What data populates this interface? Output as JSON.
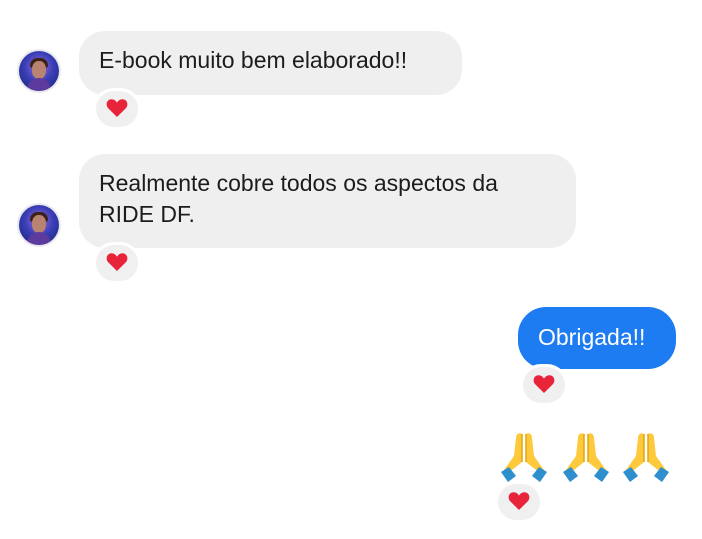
{
  "messages": [
    {
      "sender": "other",
      "text": "E-book muito bem elaborado!!",
      "reaction": "heart-icon"
    },
    {
      "sender": "other",
      "text": "Realmente cobre todos os aspectos da RIDE DF.",
      "reaction": "heart-icon"
    },
    {
      "sender": "me",
      "text": "Obrigada!!",
      "reaction": "heart-icon"
    },
    {
      "sender": "me",
      "emoji": [
        "folded-hands-icon",
        "folded-hands-icon",
        "folded-hands-icon"
      ],
      "reaction": "heart-icon"
    }
  ],
  "colors": {
    "incoming_bubble": "#efefef",
    "outgoing_bubble": "#1d7cf2",
    "reaction_bg": "#f0f0f0",
    "heart": "#e8243b"
  }
}
